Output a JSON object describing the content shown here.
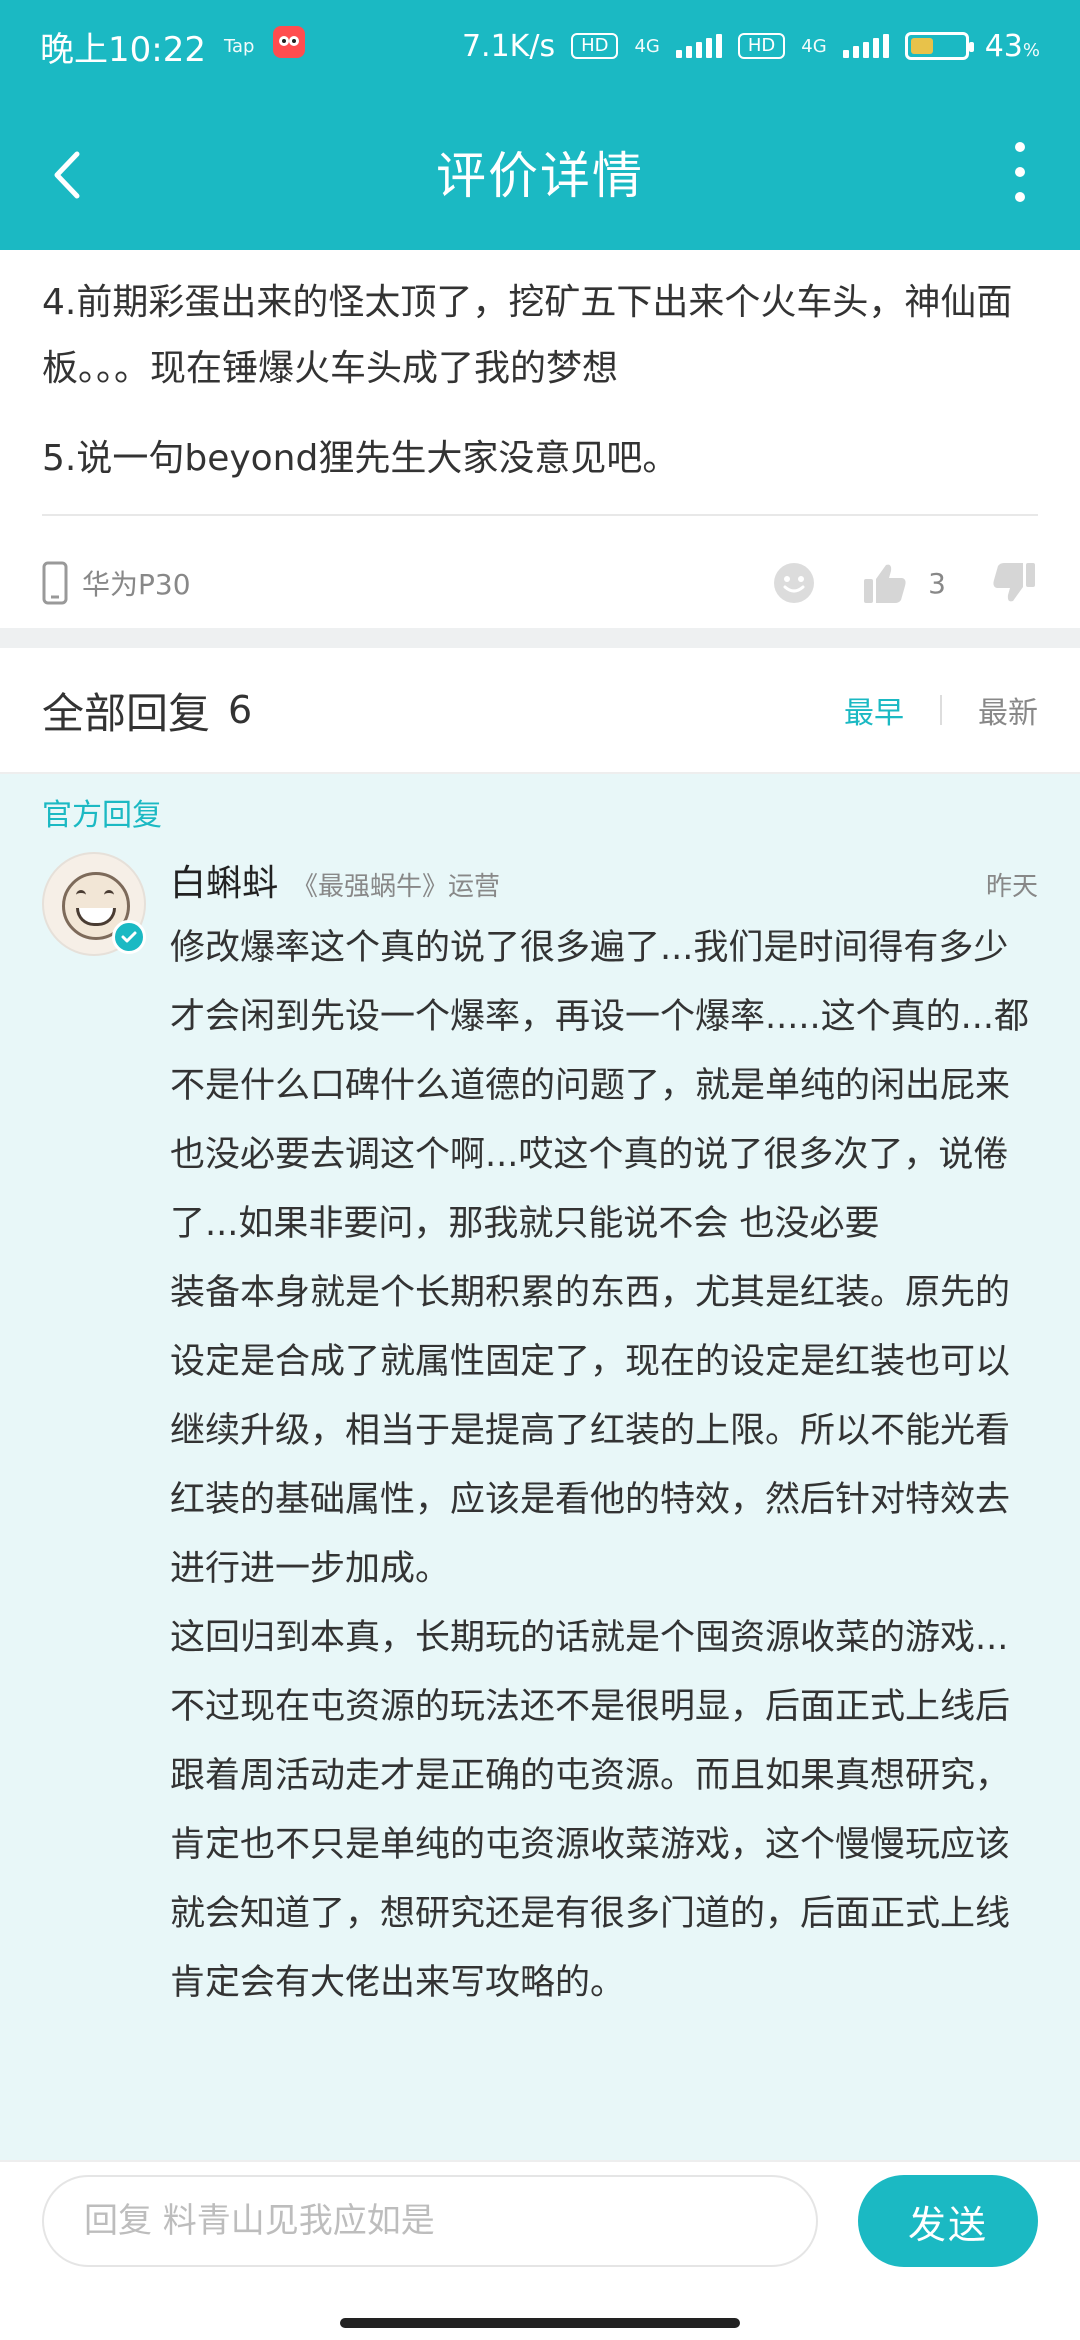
{
  "status_bar": {
    "time": "晚上10:22",
    "app_badges": [
      "Tap"
    ],
    "network_speed": "7.1K/s",
    "hd_label": "HD",
    "network_type": "4G",
    "battery_percent": "43",
    "percent_sign": "%"
  },
  "header": {
    "title": "评价详情",
    "icons": {
      "back": "back-arrow-icon",
      "more": "more-vertical-icon"
    }
  },
  "review": {
    "lines": [
      "4.前期彩蛋出来的怪太顶了，挖矿五下出来个火车头，神仙面板。。。现在锤爆火车头成了我的梦想",
      "5.说一句beyond狸先生大家没意见吧。"
    ],
    "device": "华为P30",
    "like_count": "3"
  },
  "replies": {
    "title": "全部回复",
    "count": "6",
    "sort_options": {
      "earliest": "最早",
      "latest": "最新",
      "active": "最早"
    }
  },
  "official_reply": {
    "label": "官方回复",
    "author_name": "白蝌蚪",
    "author_role": "《最强蜗牛》运营",
    "time": "昨天",
    "paragraphs": [
      "修改爆率这个真的说了很多遍了...我们是时间得有多少才会闲到先设一个爆率，再设一个爆率.....这个真的...都不是什么口碑什么道德的问题了，就是单纯的闲出屁来也没必要去调这个啊...哎这个真的说了很多次了，说倦了...如果非要问，那我就只能说不会 也没必要",
      "装备本身就是个长期积累的东西，尤其是红装。原先的设定是合成了就属性固定了，现在的设定是红装也可以继续升级，相当于是提高了红装的上限。所以不能光看红装的基础属性，应该是看他的特效，然后针对特效去进行进一步加成。",
      "这回归到本真，长期玩的话就是个囤资源收菜的游戏...不过现在屯资源的玩法还不是很明显，后面正式上线后跟着周活动走才是正确的屯资源。而且如果真想研究，肯定也不只是单纯的屯资源收菜游戏，这个慢慢玩应该就会知道了，想研究还是有很多门道的，后面正式上线肯定会有大佬出来写攻略的。"
    ]
  },
  "input_bar": {
    "placeholder": "回复 料青山见我应如是",
    "value": "",
    "send_label": "发送"
  },
  "colors": {
    "accent": "#1bb9c3",
    "official_bg": "#e8f7f8",
    "text": "#333333",
    "muted": "#888888"
  }
}
